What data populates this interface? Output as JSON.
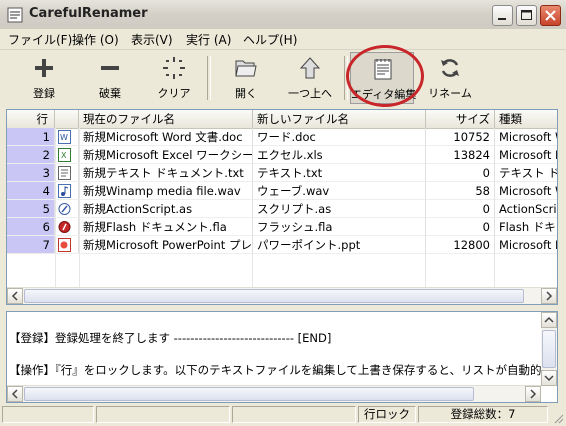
{
  "window": {
    "title": "CarefulRenamer"
  },
  "menu": [
    {
      "label": "ファイル(F)"
    },
    {
      "label": "操作 (O)"
    },
    {
      "label": "表示(V)"
    },
    {
      "label": "実行 (A)"
    },
    {
      "label": "ヘルプ(H)"
    }
  ],
  "toolbar": [
    {
      "label": "登録",
      "icon": "plus-icon"
    },
    {
      "label": "破棄",
      "icon": "minus-icon"
    },
    {
      "label": "クリア",
      "icon": "sparkle-clear-icon"
    },
    {
      "label": "開く",
      "icon": "folder-open-icon"
    },
    {
      "label": "一つ上へ",
      "icon": "up-arrow-icon"
    },
    {
      "label": "エディタ編集",
      "icon": "notepad-edit-icon"
    },
    {
      "label": "リネーム",
      "icon": "refresh-rename-icon"
    }
  ],
  "table": {
    "headers": [
      "行",
      "",
      "現在のファイル名",
      "新しいファイル名",
      "サイズ",
      "種類"
    ],
    "rows": [
      {
        "num": "1",
        "icon": "word-file-icon",
        "current": "新規Microsoft Word 文書.doc",
        "new": "ワード.doc",
        "size": "10752",
        "type": "Microsoft W"
      },
      {
        "num": "2",
        "icon": "excel-file-icon",
        "current": "新規Microsoft Excel ワークシー...",
        "new": "エクセル.xls",
        "size": "13824",
        "type": "Microsoft E"
      },
      {
        "num": "3",
        "icon": "text-file-icon",
        "current": "新規テキスト ドキュメント.txt",
        "new": "テキスト.txt",
        "size": "0",
        "type": "テキスト ドキ"
      },
      {
        "num": "4",
        "icon": "wav-file-icon",
        "current": "新規Winamp media file.wav",
        "new": "ウェーブ.wav",
        "size": "58",
        "type": "Microsoft W"
      },
      {
        "num": "5",
        "icon": "actionscript-file-icon",
        "current": "新規ActionScript.as",
        "new": "スクリプト.as",
        "size": "0",
        "type": "ActionScript"
      },
      {
        "num": "6",
        "icon": "flash-file-icon",
        "current": "新規Flash ドキュメント.fla",
        "new": "フラッシュ.fla",
        "size": "0",
        "type": "Flash ドキュ"
      },
      {
        "num": "7",
        "icon": "powerpoint-file-icon",
        "current": "新規Microsoft PowerPoint プレ...",
        "new": "パワーポイント.ppt",
        "size": "12800",
        "type": "Microsoft Po"
      }
    ]
  },
  "log": {
    "lines": [
      "【登録】登録処理を終了します ----------------------------- [END]",
      "【操作】『行』をロックします。以下のテキストファイルを編集して上書き保存すると、リストが自動的に更新されます。(c"
    ]
  },
  "status": {
    "panes": [
      "",
      "",
      "",
      "行ロック",
      "登録総数：7"
    ]
  },
  "colors": {
    "row_number_bg": "#c9c6f5",
    "highlight_circle": "#c8262a"
  }
}
